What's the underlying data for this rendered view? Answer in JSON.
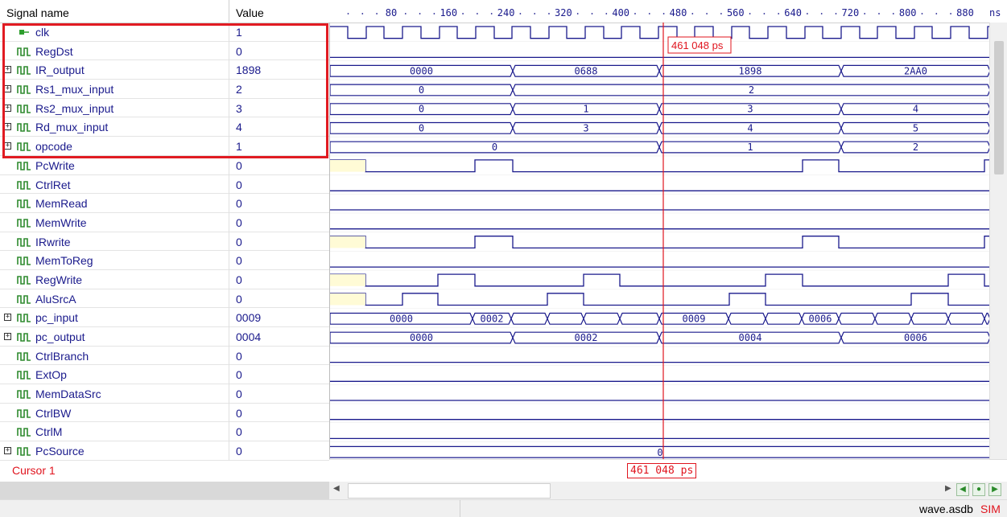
{
  "header": {
    "signal_name": "Signal name",
    "value": "Value",
    "time_unit": "ns",
    "ticks": [
      "80",
      "160",
      "240",
      "320",
      "400",
      "480",
      "560",
      "640",
      "720",
      "800",
      "880"
    ]
  },
  "signals": [
    {
      "name": "clk",
      "value": "1",
      "kind": "clock",
      "expand": false
    },
    {
      "name": "RegDst",
      "value": "0",
      "kind": "bit",
      "expand": false
    },
    {
      "name": "IR_output",
      "value": "1898",
      "kind": "bus",
      "expand": true
    },
    {
      "name": "Rs1_mux_input",
      "value": "2",
      "kind": "bus",
      "expand": true
    },
    {
      "name": "Rs2_mux_input",
      "value": "3",
      "kind": "bus",
      "expand": true
    },
    {
      "name": "Rd_mux_input",
      "value": "4",
      "kind": "bus",
      "expand": true
    },
    {
      "name": "opcode",
      "value": "1",
      "kind": "bus",
      "expand": true
    },
    {
      "name": "PcWrite",
      "value": "0",
      "kind": "bit",
      "expand": false
    },
    {
      "name": "CtrlRet",
      "value": "0",
      "kind": "bit",
      "expand": false
    },
    {
      "name": "MemRead",
      "value": "0",
      "kind": "bit",
      "expand": false
    },
    {
      "name": "MemWrite",
      "value": "0",
      "kind": "bit",
      "expand": false
    },
    {
      "name": "IRwrite",
      "value": "0",
      "kind": "bit",
      "expand": false
    },
    {
      "name": "MemToReg",
      "value": "0",
      "kind": "bit",
      "expand": false
    },
    {
      "name": "RegWrite",
      "value": "0",
      "kind": "bit",
      "expand": false
    },
    {
      "name": "AluSrcA",
      "value": "0",
      "kind": "bit",
      "expand": false
    },
    {
      "name": "pc_input",
      "value": "0009",
      "kind": "bus",
      "expand": true
    },
    {
      "name": "pc_output",
      "value": "0004",
      "kind": "bus",
      "expand": true
    },
    {
      "name": "CtrlBranch",
      "value": "0",
      "kind": "bit",
      "expand": false
    },
    {
      "name": "ExtOp",
      "value": "0",
      "kind": "bit",
      "expand": false
    },
    {
      "name": "MemDataSrc",
      "value": "0",
      "kind": "bit",
      "expand": false
    },
    {
      "name": "CtrlBW",
      "value": "0",
      "kind": "bit",
      "expand": false
    },
    {
      "name": "CtrlM",
      "value": "0",
      "kind": "bit",
      "expand": false
    },
    {
      "name": "PcSource",
      "value": "0",
      "kind": "bus",
      "expand": true
    }
  ],
  "bus_labels": {
    "IR_output": [
      "0000",
      "0688",
      "1898",
      "2AA0"
    ],
    "Rs1_mux_input": [
      "0",
      "2"
    ],
    "Rs2_mux_input": [
      "0",
      "1",
      "3",
      "4"
    ],
    "Rd_mux_input": [
      "0",
      "3",
      "4",
      "5"
    ],
    "opcode": [
      "0",
      "1",
      "2"
    ],
    "pc_input": [
      "0000",
      "0002",
      "0009",
      "0006"
    ],
    "pc_output": [
      "0000",
      "0002",
      "0004",
      "0006"
    ],
    "PcSource": [
      "0"
    ]
  },
  "cursor": {
    "label": "Cursor 1",
    "time": "461 048 ps",
    "time_bottom": "461 048 ps"
  },
  "status": {
    "file": "wave.asdb",
    "mode": "SIM"
  },
  "colors": {
    "wave": "#1a1a8c",
    "cursor": "#e0141e",
    "highlight": "#e11b22"
  }
}
